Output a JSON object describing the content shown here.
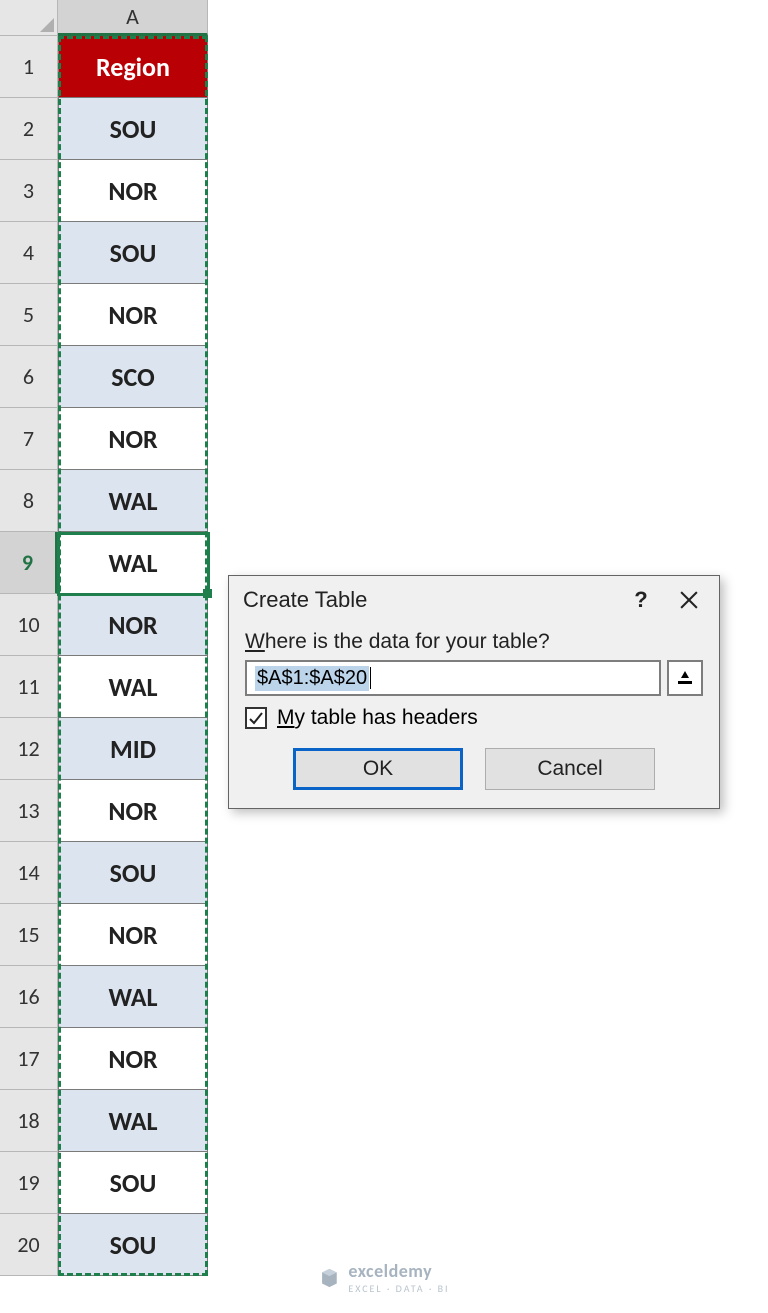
{
  "grid": {
    "column_letter": "A",
    "header_label": "Region",
    "row_numbers": [
      "1",
      "2",
      "3",
      "4",
      "5",
      "6",
      "7",
      "8",
      "9",
      "10",
      "11",
      "12",
      "13",
      "14",
      "15",
      "16",
      "17",
      "18",
      "19",
      "20"
    ],
    "cells": [
      "SOU",
      "NOR",
      "SOU",
      "NOR",
      "SCO",
      "NOR",
      "WAL",
      "WAL",
      "NOR",
      "WAL",
      "MID",
      "NOR",
      "SOU",
      "NOR",
      "WAL",
      "NOR",
      "WAL",
      "SOU",
      "SOU"
    ],
    "active_row": 9,
    "selection_range": "A1:A20"
  },
  "dialog": {
    "title": "Create Table",
    "question": "Where is the data for your table?",
    "question_underline_char": "W",
    "range_value": "$A$1:$A$20",
    "checkbox_label_pre": "M",
    "checkbox_label_rest": "y table has headers",
    "checkbox_checked": true,
    "ok_label": "OK",
    "cancel_label": "Cancel"
  },
  "watermark": {
    "brand": "exceldemy",
    "tagline": "EXCEL · DATA · BI"
  }
}
